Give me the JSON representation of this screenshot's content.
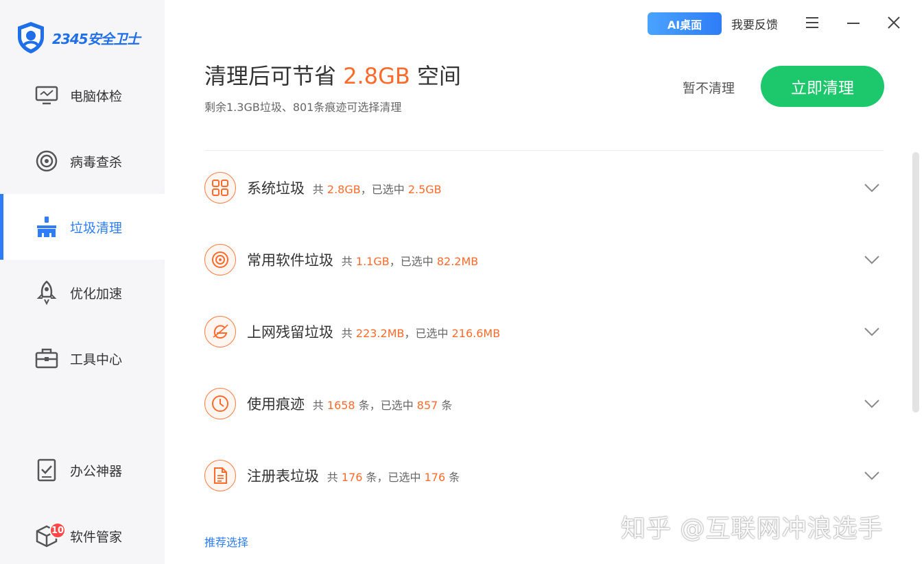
{
  "app": {
    "logo_text": "2345安全卫士"
  },
  "topbar": {
    "ai_button": "AI桌面",
    "feedback": "我要反馈"
  },
  "sidebar": {
    "items": [
      {
        "label": "电脑体检",
        "icon": "monitor-icon"
      },
      {
        "label": "病毒查杀",
        "icon": "target-icon"
      },
      {
        "label": "垃圾清理",
        "icon": "broom-icon",
        "active": true
      },
      {
        "label": "优化加速",
        "icon": "rocket-icon"
      },
      {
        "label": "工具中心",
        "icon": "toolbox-icon"
      },
      {
        "label": "办公神器",
        "icon": "checklist-icon"
      },
      {
        "label": "软件管家",
        "icon": "box-icon",
        "badge": "10"
      }
    ]
  },
  "header": {
    "title_prefix": "清理后可节省",
    "title_amount": "2.8GB",
    "title_suffix": "空间",
    "subtitle": "剩余1.3GB垃圾、801条痕迹可选择清理",
    "skip_label": "暂不清理",
    "clean_label": "立即清理"
  },
  "rows": [
    {
      "title": "系统垃圾",
      "total_prefix": "共",
      "total": "2.8GB",
      "sep": "，已选中",
      "selected": "2.5GB",
      "unit": "",
      "icon": "grid-icon"
    },
    {
      "title": "常用软件垃圾",
      "total_prefix": "共",
      "total": "1.1GB",
      "sep": "，已选中",
      "selected": "82.2MB",
      "unit": "",
      "icon": "disc-icon"
    },
    {
      "title": "上网残留垃圾",
      "total_prefix": "共",
      "total": "223.2MB",
      "sep": "，已选中",
      "selected": "216.6MB",
      "unit": "",
      "icon": "browser-icon"
    },
    {
      "title": "使用痕迹",
      "total_prefix": "共",
      "total": "1658",
      "sep": " 条，已选中",
      "selected": "857",
      "unit": " 条",
      "icon": "clock-icon"
    },
    {
      "title": "注册表垃圾",
      "total_prefix": "共",
      "total": "176",
      "sep": " 条，已选中",
      "selected": "176",
      "unit": " 条",
      "icon": "document-icon"
    }
  ],
  "footer": {
    "recommend": "推荐选择",
    "watermark": "知乎 @互联网冲浪选手"
  },
  "colors": {
    "accent_blue": "#2f7df6",
    "accent_orange": "#ff6a2b",
    "clean_green": "#1dc76b"
  }
}
